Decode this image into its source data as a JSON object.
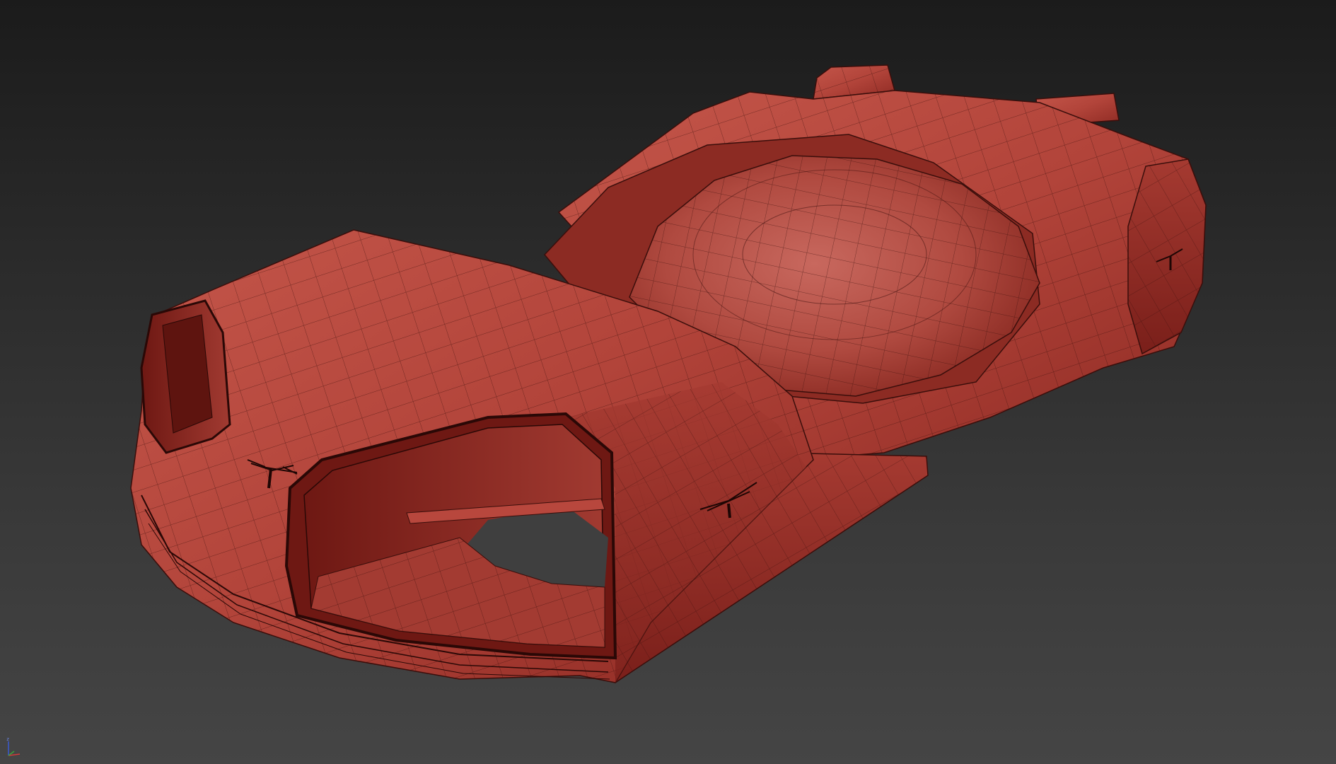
{
  "viewport": {
    "background_top": "#1b1b1b",
    "background_bottom": "#454545"
  },
  "model": {
    "material_color": "#b8473d",
    "material_shadow": "#7a1f1a",
    "material_highlight": "#c85a4e",
    "wire_color": "#3a0e0b",
    "emblem_icon": "winged-t-emblem-icon"
  },
  "axis_gizmo": {
    "z_label": "z",
    "x_color": "#d23a3a",
    "y_color": "#3aa63a",
    "z_color": "#3a5ad2"
  }
}
